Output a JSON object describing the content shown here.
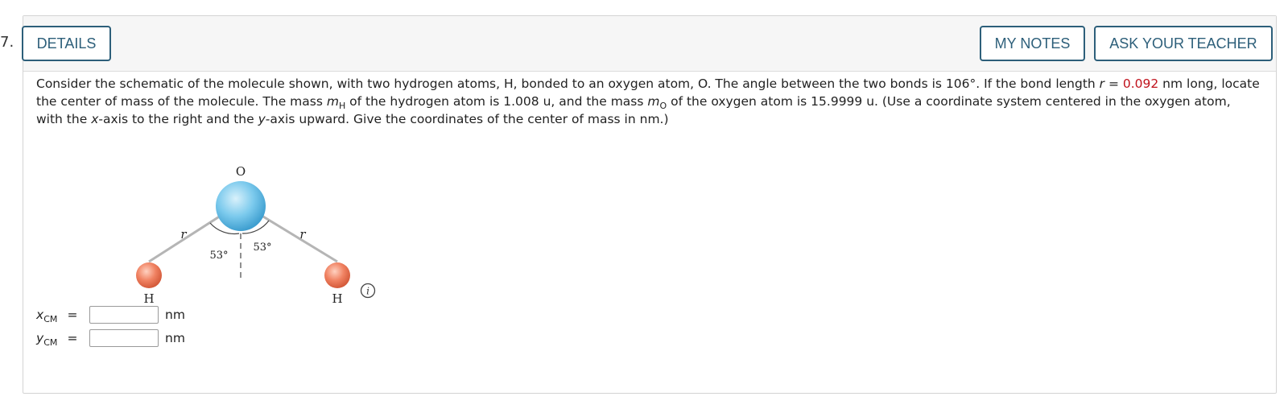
{
  "question": {
    "number": "7.",
    "details_label": "DETAILS",
    "my_notes_label": "MY NOTES",
    "ask_teacher_label": "ASK YOUR TEACHER",
    "text_part1": "Consider the schematic of the molecule shown, with two hydrogen atoms, H, bonded to an oxygen atom, O. The angle between the two bonds is 106°. If the bond length ",
    "r_symbol": "r",
    "equals": " = ",
    "bond_length_value": "0.092",
    "text_part2": " nm long, locate the center of mass of the molecule. The mass ",
    "mH_symbol": "m",
    "mH_sub": "H",
    "text_part3": " of the hydrogen atom is 1.008 u, and the mass ",
    "mO_symbol": "m",
    "mO_sub": "O",
    "text_part4": " of the oxygen atom is 15.9999 u. (Use a coordinate system centered in the oxygen atom, with the ",
    "x_axis_symbol": "x",
    "text_part5": "-axis to the right and the ",
    "y_axis_symbol": "y",
    "text_part6": "-axis upward. Give the coordinates of the center of mass in nm.)"
  },
  "figure": {
    "oxygen_label": "O",
    "hydrogen_left_label": "H",
    "hydrogen_right_label": "H",
    "bond_left_label": "r",
    "bond_right_label": "r",
    "angle_left_label": "53°",
    "angle_right_label": "53°",
    "oxygen_color": "#6cbfe6",
    "hydrogen_color": "#ef7f5d",
    "bond_color": "#b5b5b5"
  },
  "info_icon": "i",
  "answers": {
    "x_label": "x",
    "x_sub": "CM",
    "y_label": "y",
    "y_sub": "CM",
    "equals": "=",
    "x_value": "",
    "y_value": "",
    "unit": "nm"
  }
}
